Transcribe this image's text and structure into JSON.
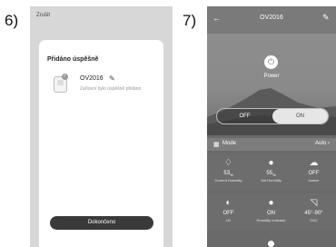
{
  "steps": {
    "left": "6)",
    "right": "7)"
  },
  "screen6": {
    "cancel": "Zrušit",
    "title": "Přidáno úspěšně",
    "device_name": "OV2016",
    "device_sub": "Zařízení bylo úspěšně přidáno",
    "done_button": "Dokončeno",
    "icons": [
      "purifier-device-icon",
      "check-icon",
      "pencil-icon"
    ]
  },
  "screen7": {
    "title": "OV2016",
    "power_label": "Power",
    "toggle": {
      "off": "OFF",
      "on": "ON",
      "selected": "ON"
    },
    "mode": {
      "label": "Mode",
      "value": "Auto"
    },
    "row1": [
      {
        "icon": "humidity-drop-icon",
        "value": "53",
        "unit": "%",
        "label": "Current Humidity"
      },
      {
        "icon": "drop-icon",
        "value": "55",
        "unit": "%",
        "label": "Set Humidity"
      },
      {
        "icon": "cloud-icon",
        "value": "OFF",
        "unit": "",
        "label": "Ionizer"
      }
    ],
    "row2": [
      {
        "icon": "uv-shield-icon",
        "value": "OFF",
        "unit": "",
        "label": "UV"
      },
      {
        "icon": "bulb-icon",
        "value": "ON",
        "unit": "",
        "label": "Humidity Indicator"
      },
      {
        "icon": "oscillation-icon",
        "value": "45°-90°",
        "unit": "",
        "label": "OSC"
      }
    ]
  }
}
